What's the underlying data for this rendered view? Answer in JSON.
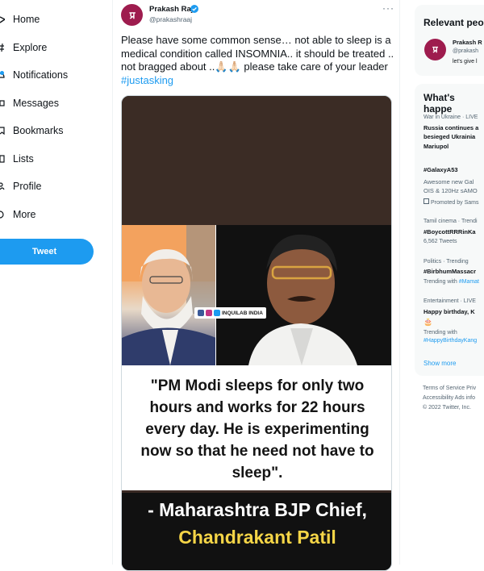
{
  "nav": {
    "items": [
      {
        "label": "Home",
        "icon": "home-icon"
      },
      {
        "label": "Explore",
        "icon": "hash-icon"
      },
      {
        "label": "Notifications",
        "icon": "bell-icon"
      },
      {
        "label": "Messages",
        "icon": "envelope-icon"
      },
      {
        "label": "Bookmarks",
        "icon": "bookmark-icon"
      },
      {
        "label": "Lists",
        "icon": "list-icon"
      },
      {
        "label": "Profile",
        "icon": "user-icon"
      },
      {
        "label": "More",
        "icon": "more-circle-icon"
      }
    ],
    "tweet_button": "Tweet"
  },
  "tweet": {
    "author": {
      "name": "Prakash Raj",
      "handle": "@prakashraaj",
      "avatar_text": "प्र"
    },
    "text": "Please have some common sense… not able to sleep is a medical condition called INSOMNIA.. it should be treated .. not bragged about ..🙏🏻🙏🏻 please take care of your leader ",
    "hashtag": "#justasking",
    "media": {
      "watermark": "INQUILAB INDIA",
      "quote": "\"PM Modi sleeps for only two hours and works for 22 hours every day. He is experimenting now so that he need not have to sleep\".",
      "attribution_line1": "- Maharashtra BJP Chief,",
      "attribution_line2": "Chandrakant Patil"
    }
  },
  "relevant": {
    "title": "Relevant peo",
    "person": {
      "name": "Prakash R",
      "handle": "@prakash",
      "bio": "let's give l"
    }
  },
  "trends": {
    "title": "What's happe",
    "items": [
      {
        "context": "War in Ukraine · LIVE",
        "title_lines": [
          "Russia continues a",
          "besieged Ukrainia",
          "Mariupol"
        ]
      },
      {
        "context": "",
        "title_lines": [
          "#GalaxyA53"
        ],
        "desc_lines": [
          "Awesome new Gal",
          "OIS & 120Hz sAMO"
        ],
        "promoted": "Promoted by Sams"
      },
      {
        "context": "Tamil cinema · Trendi",
        "title_lines": [
          "#BoycottRRRinKa"
        ],
        "meta": "6,562 Tweets"
      },
      {
        "context": "Politics · Trending",
        "title_lines": [
          "#BirbhumMassacr"
        ],
        "trending_with": "Trending with ",
        "trending_tag": "#Mamat"
      },
      {
        "context": "Entertainment · LIVE",
        "title_lines": [
          "Happy birthday, K"
        ],
        "emoji": "🎂",
        "trending_with": "Trending with",
        "trending_tag": "#HappyBirthdayKang"
      }
    ],
    "show_more": "Show more"
  },
  "footer": {
    "line1": "Terms of Service   Priv",
    "line2": "Accessibility   Ads info",
    "line3": "© 2022 Twitter, Inc."
  },
  "colors": {
    "accent": "#1d9bf0",
    "avatar": "#9e1c4e",
    "highlight": "#f5d547"
  }
}
